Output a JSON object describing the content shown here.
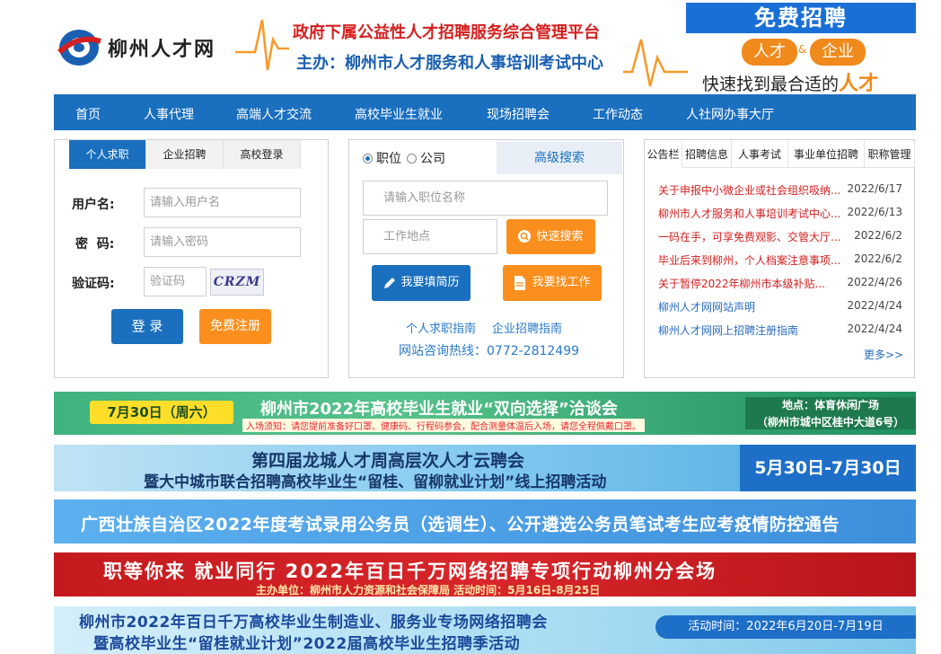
{
  "header": {
    "logo_text": "柳州人才网",
    "slogan_line1": "政府下属公益性人才招聘服务综合管理平台",
    "slogan_line2": "主办：柳州市人才服务和人事培训考试中心",
    "ad": {
      "title": "免费招聘",
      "tag_left": "人才",
      "amp": "&",
      "tag_right": "企业",
      "bottom_prefix": "快速找到最合适的",
      "bottom_highlight": "人才"
    }
  },
  "nav": {
    "items": [
      "首页",
      "人事代理",
      "高端人才交流",
      "高校毕业生就业",
      "现场招聘会",
      "工作动态",
      "人社网办事大厅"
    ]
  },
  "login": {
    "tabs": [
      "个人求职",
      "企业招聘",
      "高校登录"
    ],
    "username_label": "用户名:",
    "username_placeholder": "请输入用户名",
    "password_label": "密  码:",
    "password_placeholder": "请输入密码",
    "captcha_label": "验证码:",
    "captcha_placeholder": "验证码",
    "captcha_text": "CRZM",
    "login_button": "登 录",
    "register_button": "免费注册"
  },
  "search": {
    "radio_position": "职位",
    "radio_company": "公司",
    "advanced": "高级搜索",
    "keyword_placeholder": "请输入职位名称",
    "location_placeholder": "工作地点",
    "quick_search": "快速搜索",
    "fill_resume": "我要填简历",
    "find_job": "我要找工作",
    "guide_personal": "个人求职指南",
    "guide_company": "企业招聘指南",
    "hotline": "网站咨询热线：0772-2812499"
  },
  "notice": {
    "tabs": [
      "公告栏",
      "招聘信息",
      "人事考试",
      "事业单位招聘",
      "职称管理"
    ],
    "rows": [
      {
        "title": "关于申报中小微企业或社会组织吸纳...",
        "date": "2022/6/17",
        "color": "red"
      },
      {
        "title": "柳州市人才服务和人事培训考试中心...",
        "date": "2022/6/13",
        "color": "red"
      },
      {
        "title": "一码在手，可享免费观影、交管大厅...",
        "date": "2022/6/2",
        "color": "red"
      },
      {
        "title": "毕业后来到柳州，个人档案注意事项...",
        "date": "2022/6/2",
        "color": "red"
      },
      {
        "title": "关于暂停2022年柳州市本级补贴...",
        "date": "2022/4/26",
        "color": "red"
      },
      {
        "title": "柳州人才网网站声明",
        "date": "2022/4/24",
        "color": "blue"
      },
      {
        "title": "柳州人才网网上招聘注册指南",
        "date": "2022/4/24",
        "color": "blue"
      }
    ],
    "more": "更多>>"
  },
  "banners": {
    "b1": {
      "date": "7月30日（周六）",
      "title": "柳州市2022年高校毕业生就业“双向选择”洽谈会",
      "notice": "入场须知：请您提前准备好口罩、健康码、行程码参会，配合测量体温后入场，请您全程佩戴口罩。",
      "place_line1": "地点：体育休闲广场",
      "place_line2": "（柳州市城中区桂中大道6号）"
    },
    "b2": {
      "line1": "第四届龙城人才周高层次人才云聘会",
      "line2": "暨大中城市联合招聘高校毕业生“留桂、留柳就业计划”线上招聘活动",
      "date": "5月30日-7月30日"
    },
    "b3": {
      "text": "广西壮族自治区2022年度考试录用公务员（选调生）、公开遴选公务员笔试考生应考疫情防控通告"
    },
    "b4": {
      "title": "职等你来 就业同行 2022年百日千万网络招聘专项行动柳州分会场",
      "sub": "主办单位：柳州市人力资源和社会保障局    活动时间：5月16日-8月25日"
    },
    "b5": {
      "line1": "柳州市2022年百日千万高校毕业生制造业、服务业专场网络招聘会",
      "line2": "暨高校毕业生“留桂就业计划”2022届高校毕业生招聘季活动",
      "date": "活动时间：2022年6月20日-7月19日"
    }
  }
}
